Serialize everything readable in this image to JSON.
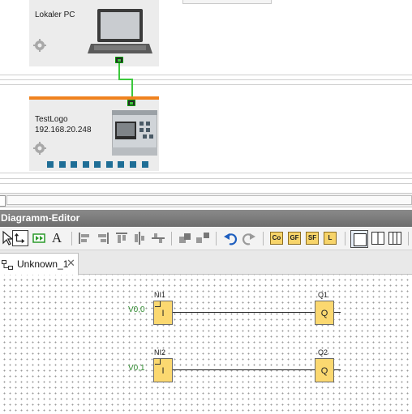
{
  "network": {
    "devices": [
      {
        "name": "Lokaler PC",
        "ip": ""
      },
      {
        "name": "TestLogo",
        "ip": "192.168.20.248"
      }
    ],
    "colors": {
      "accent_strip": "#f0821e",
      "link": "#3cc83c",
      "io": "#1f6e96"
    }
  },
  "editor": {
    "title": "Diagramm-Editor",
    "toolbar": {
      "text_tool": "A",
      "block_buttons": [
        "Co",
        "GF",
        "SF",
        "L"
      ]
    },
    "tab": {
      "label": "Unknown_1",
      "close": "✕"
    }
  },
  "diagram": {
    "rows": [
      {
        "input_block": "NI1",
        "input_symbol": "I",
        "signal": "V0,0",
        "output_block": "Q1",
        "output_symbol": "Q"
      },
      {
        "input_block": "NI2",
        "input_symbol": "I",
        "signal": "V0,1",
        "output_block": "Q2",
        "output_symbol": "Q"
      }
    ]
  }
}
